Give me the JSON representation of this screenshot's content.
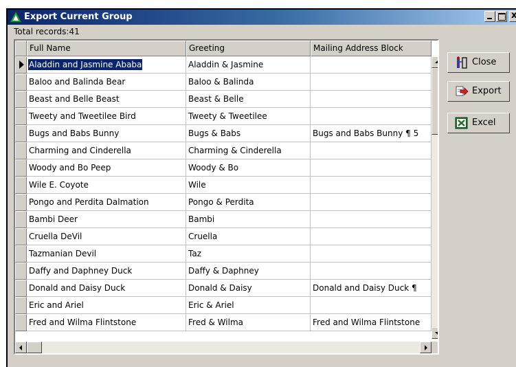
{
  "window": {
    "title": "Export Current Group",
    "close_glyph": "x",
    "icons": {
      "app": "green-triangle-icon"
    }
  },
  "records": {
    "label": "Total records:",
    "count": "41"
  },
  "columns": [
    "Full Name",
    "Greeting",
    "Mailing Address Block"
  ],
  "rows": [
    {
      "name": "Aladdin and Jasmine Ababa",
      "greeting": "Aladdin & Jasmine",
      "address": ""
    },
    {
      "name": "Baloo and Balinda Bear",
      "greeting": "Baloo & Balinda",
      "address": ""
    },
    {
      "name": "Beast and Belle Beast",
      "greeting": "Beast & Belle",
      "address": ""
    },
    {
      "name": "Tweety and Tweetilee Bird",
      "greeting": "Tweety & Tweetilee",
      "address": ""
    },
    {
      "name": "Bugs and Babs Bunny",
      "greeting": "Bugs & Babs",
      "address": "Bugs and Babs Bunny ¶ 5"
    },
    {
      "name": "Charming and Cinderella",
      "greeting": "Charming & Cinderella",
      "address": ""
    },
    {
      "name": "Woody and Bo Peep",
      "greeting": "Woody & Bo",
      "address": ""
    },
    {
      "name": "Wile E. Coyote",
      "greeting": "Wile",
      "address": ""
    },
    {
      "name": "Pongo and Perdita Dalmation",
      "greeting": "Pongo & Perdita",
      "address": ""
    },
    {
      "name": "Bambi Deer",
      "greeting": "Bambi",
      "address": ""
    },
    {
      "name": "Cruella DeVil",
      "greeting": "Cruella",
      "address": ""
    },
    {
      "name": "Tazmanian Devil",
      "greeting": "Taz",
      "address": ""
    },
    {
      "name": "Daffy and Daphney Duck",
      "greeting": "Daffy & Daphney",
      "address": ""
    },
    {
      "name": "Donald and Daisy Duck",
      "greeting": "Donald & Daisy",
      "address": "Donald and Daisy Duck ¶"
    },
    {
      "name": "Eric and Ariel",
      "greeting": "Eric & Ariel",
      "address": ""
    },
    {
      "name": "Fred and Wilma Flintstone",
      "greeting": "Fred & Wilma",
      "address": "Fred and Wilma Flintstone"
    }
  ],
  "selected_row": 0,
  "scroll": {
    "vertical_position": 0,
    "horizontal_position": 0
  },
  "buttons": {
    "close": {
      "label": "Close",
      "icon": "door-person-icon"
    },
    "export": {
      "label": "Export",
      "icon": "export-arrow-icon"
    },
    "excel": {
      "label": "Excel",
      "icon": "excel-icon"
    }
  },
  "colors": {
    "titlebar_start": "#0a246a",
    "titlebar_end": "#a6caf0",
    "selection": "#0a246a",
    "face": "#d4d0c8"
  }
}
